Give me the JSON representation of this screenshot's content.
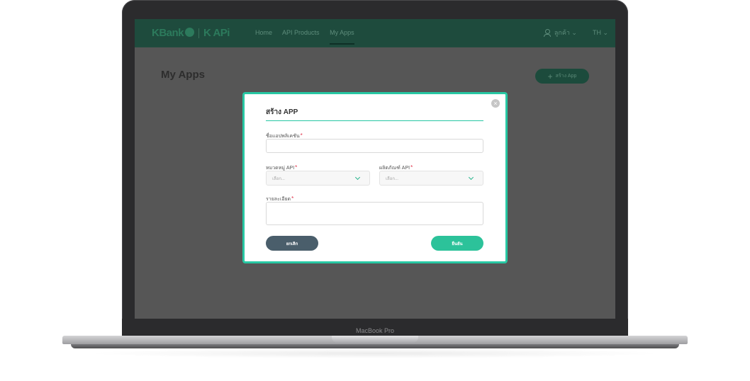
{
  "device": {
    "label": "MacBook Pro"
  },
  "navbar": {
    "logo_main": "KBank",
    "logo_sub": "K APi",
    "links": [
      {
        "label": "Home"
      },
      {
        "label": "API Products"
      },
      {
        "label": "My Apps"
      }
    ],
    "user_label": "ลูกค้า ⌄",
    "lang_label": "TH ⌄"
  },
  "page": {
    "title": "My Apps",
    "create_button_label": "สร้าง App"
  },
  "modal": {
    "close_glyph": "×",
    "title": "สร้าง APP",
    "fields": {
      "app_name": {
        "label": "ชื่อแอปพลิเคชัน",
        "required_mark": "*",
        "value": ""
      },
      "api_category": {
        "label": "หมวดหมู่ API",
        "required_mark": "*",
        "placeholder": "เลือก..."
      },
      "api_product": {
        "label": "ผลิตภัณฑ์ API",
        "required_mark": "*",
        "placeholder": "เลือก..."
      },
      "details": {
        "label": "รายละเอียด",
        "required_mark": "*",
        "value": ""
      }
    },
    "cancel_label": "ยกเลิก",
    "confirm_label": "ยืนยัน"
  },
  "colors": {
    "accent": "#27c7a3",
    "navbar": "#1e4b3d",
    "cancel": "#4a5e6b",
    "confirm": "#2cc29a",
    "required": "#e0334a"
  }
}
